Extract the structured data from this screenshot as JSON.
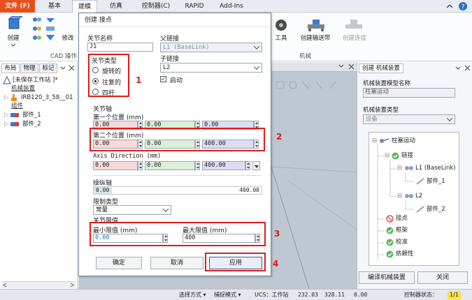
{
  "menu": {
    "file": "文件 (F)",
    "tabs": [
      "基本",
      "建模",
      "仿真",
      "控制器(C)",
      "RAPID",
      "Add-Ins"
    ]
  },
  "ribbon": {
    "create": "创建",
    "modify": "修改",
    "cad_group": "CAD 操作",
    "tool": "工具",
    "create_conveyor": "创建输送带",
    "create_connection": "创建连接",
    "mechanism_group": "机械"
  },
  "left_panel": {
    "tabs": [
      "布局",
      "物理",
      "标记"
    ],
    "station": "[未保存工作站 ]*",
    "mechanism": "机械装置",
    "robot": "IRB120_3_58__01",
    "group": "组件",
    "part1": "部件_1",
    "part2": "部件_2"
  },
  "dialog": {
    "title": "创建 接点",
    "joint_name_label": "关节名称",
    "joint_name": "J1",
    "joint_type_label": "关节类型",
    "type_rotary": "旋转的",
    "type_prismatic": "往复的",
    "type_four_bar": "四杆",
    "parent_link_label": "父链接",
    "parent_link": "L1 (BaseLink)",
    "child_link_label": "子链接",
    "child_link": "L2",
    "enable_label": "启动",
    "joint_axis_label": "关节轴",
    "first_pos_label": "第一个位置 (mm)",
    "first_pos": [
      "0.00",
      "0.00",
      "0.00"
    ],
    "second_pos_label": "第二个位置 (mm)",
    "second_pos": [
      "0.00",
      "0.00",
      "400.00"
    ],
    "axis_dir_label": "Axis Direction (mm)",
    "axis_dir": [
      "0.00",
      "0.00",
      "400.00"
    ],
    "jog_axis_label": "操纵轴",
    "jog_min": "0.00",
    "jog_max": "400.00",
    "limit_type_label": "限制类型",
    "limit_type": "常量",
    "joint_limits_label": "关节限值",
    "min_label": "最小限值 (mm)",
    "max_label": "最大限值 (mm)",
    "min_value": "0.00",
    "max_value": "400",
    "ok": "确定",
    "cancel": "取消",
    "apply": "应用",
    "annotations": [
      "1",
      "2",
      "3",
      "4"
    ]
  },
  "right_panel": {
    "tab": "创建 机械装置",
    "model_name_label": "机械装置模型名称",
    "model_name": "柱塞运动",
    "type_label": "机械装置类型",
    "type_value": "设备",
    "tree": {
      "root": "柱塞运动",
      "links": "链接",
      "l1": "L1 (BaseLink)",
      "l1_part": "部件_1",
      "l2": "L2",
      "l2_part": "部件_2",
      "joints": "接点",
      "frame": "框架",
      "calibration": "校准",
      "dependency": "依赖性"
    },
    "compile": "编译机械装置",
    "close": "关闭"
  },
  "status_bar": {
    "selection": "选择方式",
    "snap": "捕捉模式",
    "ucs": "UCS：工作站",
    "x": "232.03",
    "y": "328.11",
    "z": "0.00",
    "controller_status_label": "控制器状态：",
    "controller_status": "1/1"
  },
  "colors": {
    "file_tab": "#e84f1c",
    "annotation": "#e01b1b",
    "apply_border": "#2a5fb0"
  }
}
